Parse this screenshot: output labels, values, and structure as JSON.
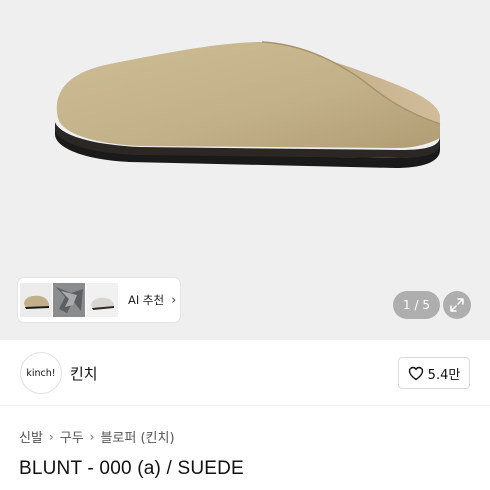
{
  "gallery": {
    "counter": "1 / 5",
    "ai_recommend_label": "AI 추천",
    "ai_chevron": "›",
    "expand_icon": "expand-icon"
  },
  "brand": {
    "logo_text": "kinch!",
    "name": "킨치",
    "like_count": "5.4만"
  },
  "breadcrumb": [
    {
      "label": "신발"
    },
    {
      "label": "구두"
    },
    {
      "label": "블로퍼 (킨치)"
    }
  ],
  "breadcrumb_separator": "›",
  "product": {
    "title": "BLUNT - 000 (a) / SUEDE"
  },
  "colors": {
    "suede": "#c6b48b",
    "sole": "#1a1a1a",
    "hero_bg": "#efefef"
  }
}
